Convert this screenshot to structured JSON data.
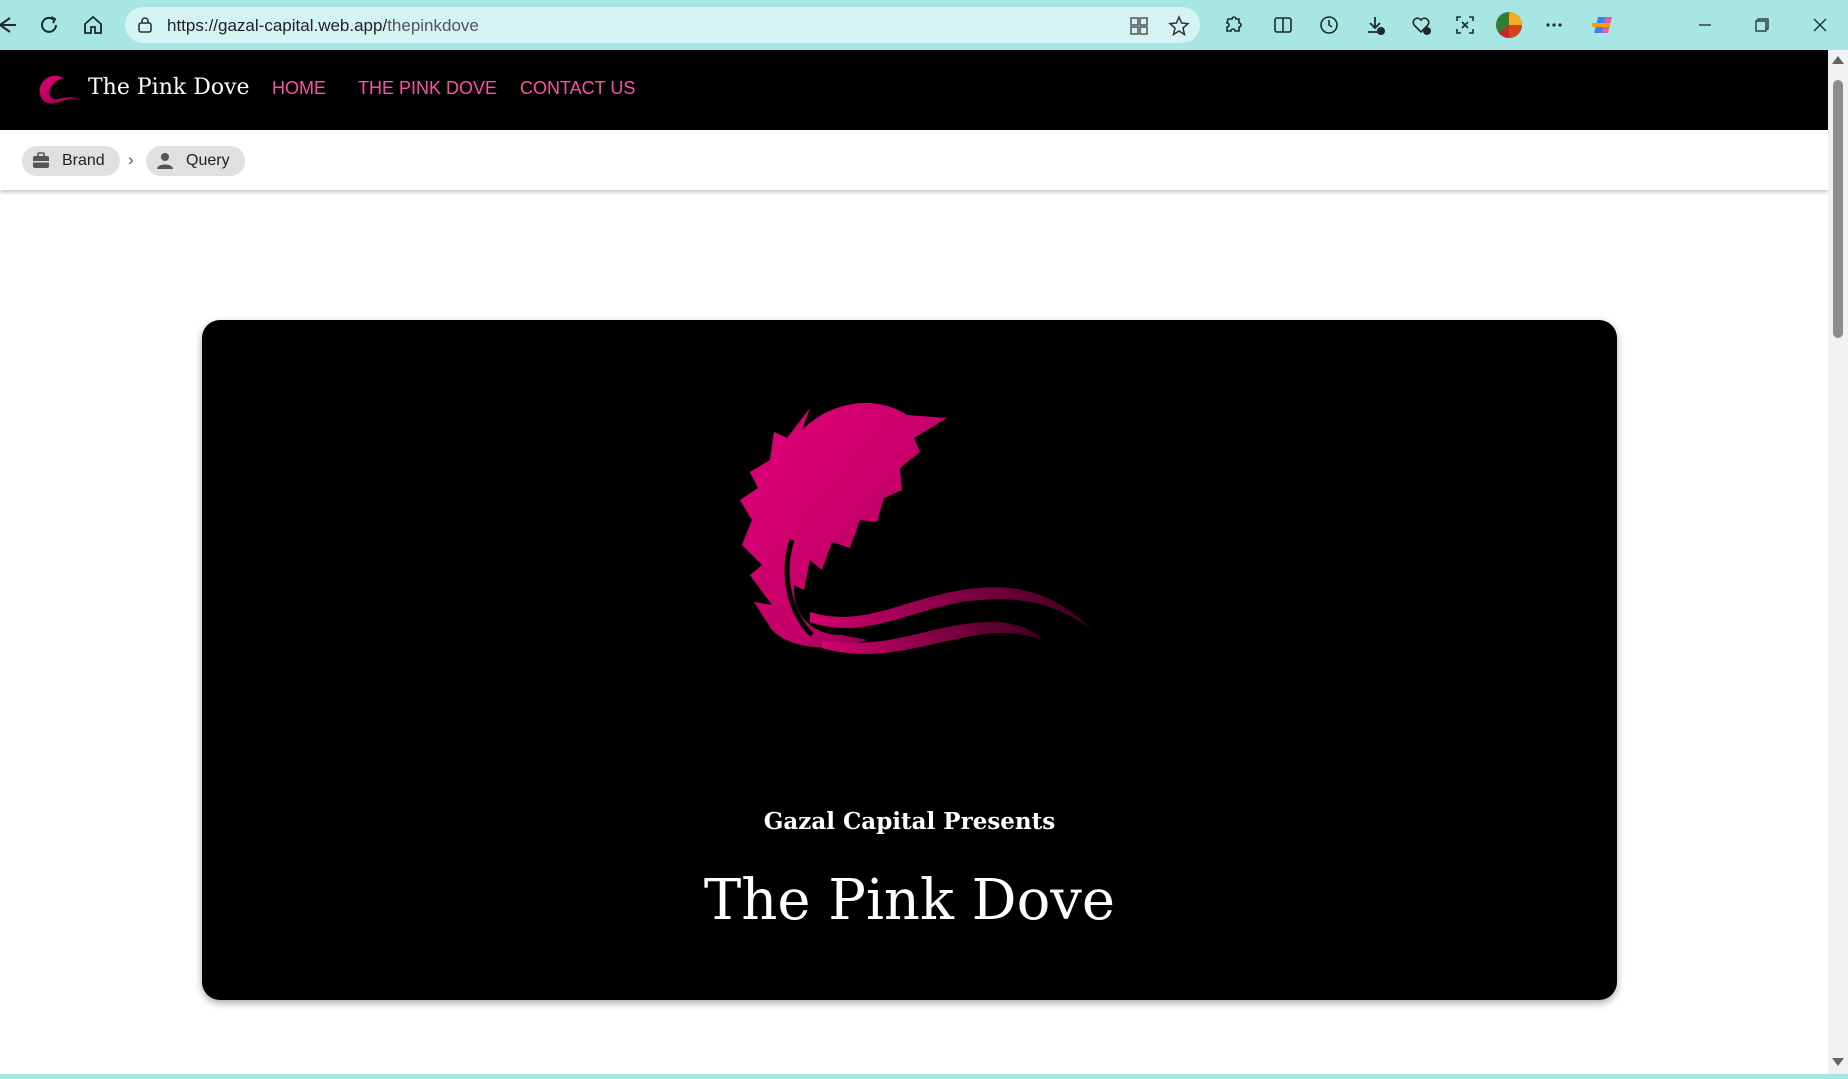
{
  "browser": {
    "url_host": "https://gazal-capital.web.app/",
    "url_path": "thepinkdove"
  },
  "site": {
    "brand_name": "The Pink Dove",
    "nav": [
      {
        "label": "HOME"
      },
      {
        "label": "THE PINK DOVE"
      },
      {
        "label": "CONTACT US"
      }
    ],
    "accent_color": "#ff4fa3",
    "brand_color": "#d6006b"
  },
  "breadcrumb": {
    "items": [
      {
        "label": "Brand",
        "icon": "briefcase-icon"
      },
      {
        "label": "Query",
        "icon": "person-icon"
      }
    ],
    "separator": "›"
  },
  "hero": {
    "presents": "Gazal Capital Presents",
    "title": "The Pink Dove",
    "logo_icon": "pink-feather-logo"
  }
}
